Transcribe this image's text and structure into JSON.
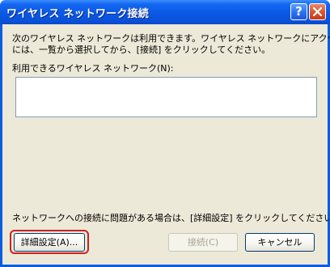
{
  "window": {
    "title": "ワイヤレス ネットワーク接続",
    "help_label": "?"
  },
  "main": {
    "instruction_line1": "次のワイヤレス ネットワークは利用できます。ワイヤレス ネットワークにアクセスする",
    "instruction_line2": "には、一覧から選択してから、[接続] をクリックしてください。",
    "available_label": "利用できるワイヤレス ネットワーク(N):",
    "networks": [],
    "problem_text": "ネットワークへの接続に問題がある場合は、[詳細設定] をクリックしてください。"
  },
  "buttons": {
    "advanced": "詳細設定(A)...",
    "connect": "接続(C)",
    "cancel": "キャンセル"
  },
  "colors": {
    "titlebar": "#0a52da",
    "dialog_face": "#ece9d8",
    "close_button": "#d9532c",
    "focus_highlight": "#d11f1f"
  }
}
